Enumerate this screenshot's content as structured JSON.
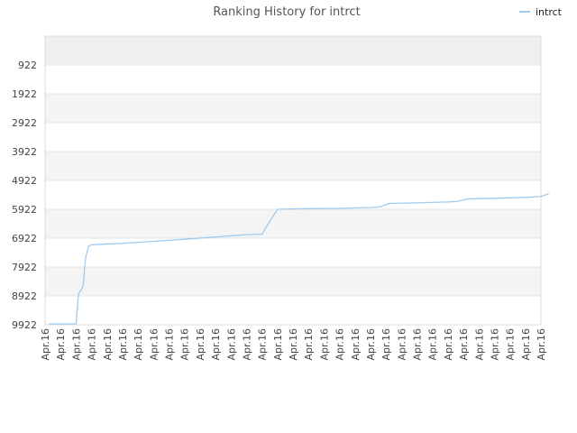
{
  "chart_data": {
    "type": "line",
    "title": "Ranking History for intrct",
    "xlabel": "",
    "ylabel": "",
    "legend": {
      "position": "top-right"
    },
    "y_inverted": true,
    "ylim": [
      -78,
      9922
    ],
    "yticks": [
      922,
      1922,
      2922,
      3922,
      4922,
      5922,
      6922,
      7922,
      8922,
      9922
    ],
    "ytick_labels": [
      "922",
      "1922",
      "2922",
      "3922",
      "4922",
      "5922",
      "6922",
      "7922",
      "8922",
      "9922"
    ],
    "xtick_labels": [
      "Apr.16",
      "Apr.16",
      "Apr.16",
      "Apr.16",
      "Apr.16",
      "Apr.16",
      "Apr.16",
      "Apr.16",
      "Apr.16",
      "Apr.16",
      "Apr.16",
      "Apr.16",
      "Apr.16",
      "Apr.16",
      "Apr.16",
      "Apr.16",
      "Apr.16",
      "Apr.16",
      "Apr.16",
      "Apr.16",
      "Apr.16",
      "Apr.16",
      "Apr.16",
      "Apr.16",
      "Apr.16",
      "Apr.16",
      "Apr.16",
      "Apr.16",
      "Apr.16",
      "Apr.16",
      "Apr.16",
      "Apr.16",
      "Apr.16"
    ],
    "series": [
      {
        "name": "intrct",
        "color": "#a0cbee",
        "x": [
          0.25,
          2,
          2.15,
          2.45,
          2.6,
          2.8,
          3,
          5,
          7,
          9,
          11,
          13,
          14,
          14.6,
          15,
          17,
          19,
          21,
          21.6,
          22.2,
          24,
          26,
          26.6,
          27.3,
          29,
          31,
          32,
          32.5
        ],
        "values": [
          9890,
          9890,
          8860,
          8600,
          7650,
          7200,
          7150,
          7100,
          7030,
          6960,
          6880,
          6800,
          6780,
          6260,
          5922,
          5900,
          5890,
          5860,
          5840,
          5720,
          5700,
          5670,
          5650,
          5560,
          5540,
          5510,
          5480,
          5380
        ]
      }
    ]
  }
}
